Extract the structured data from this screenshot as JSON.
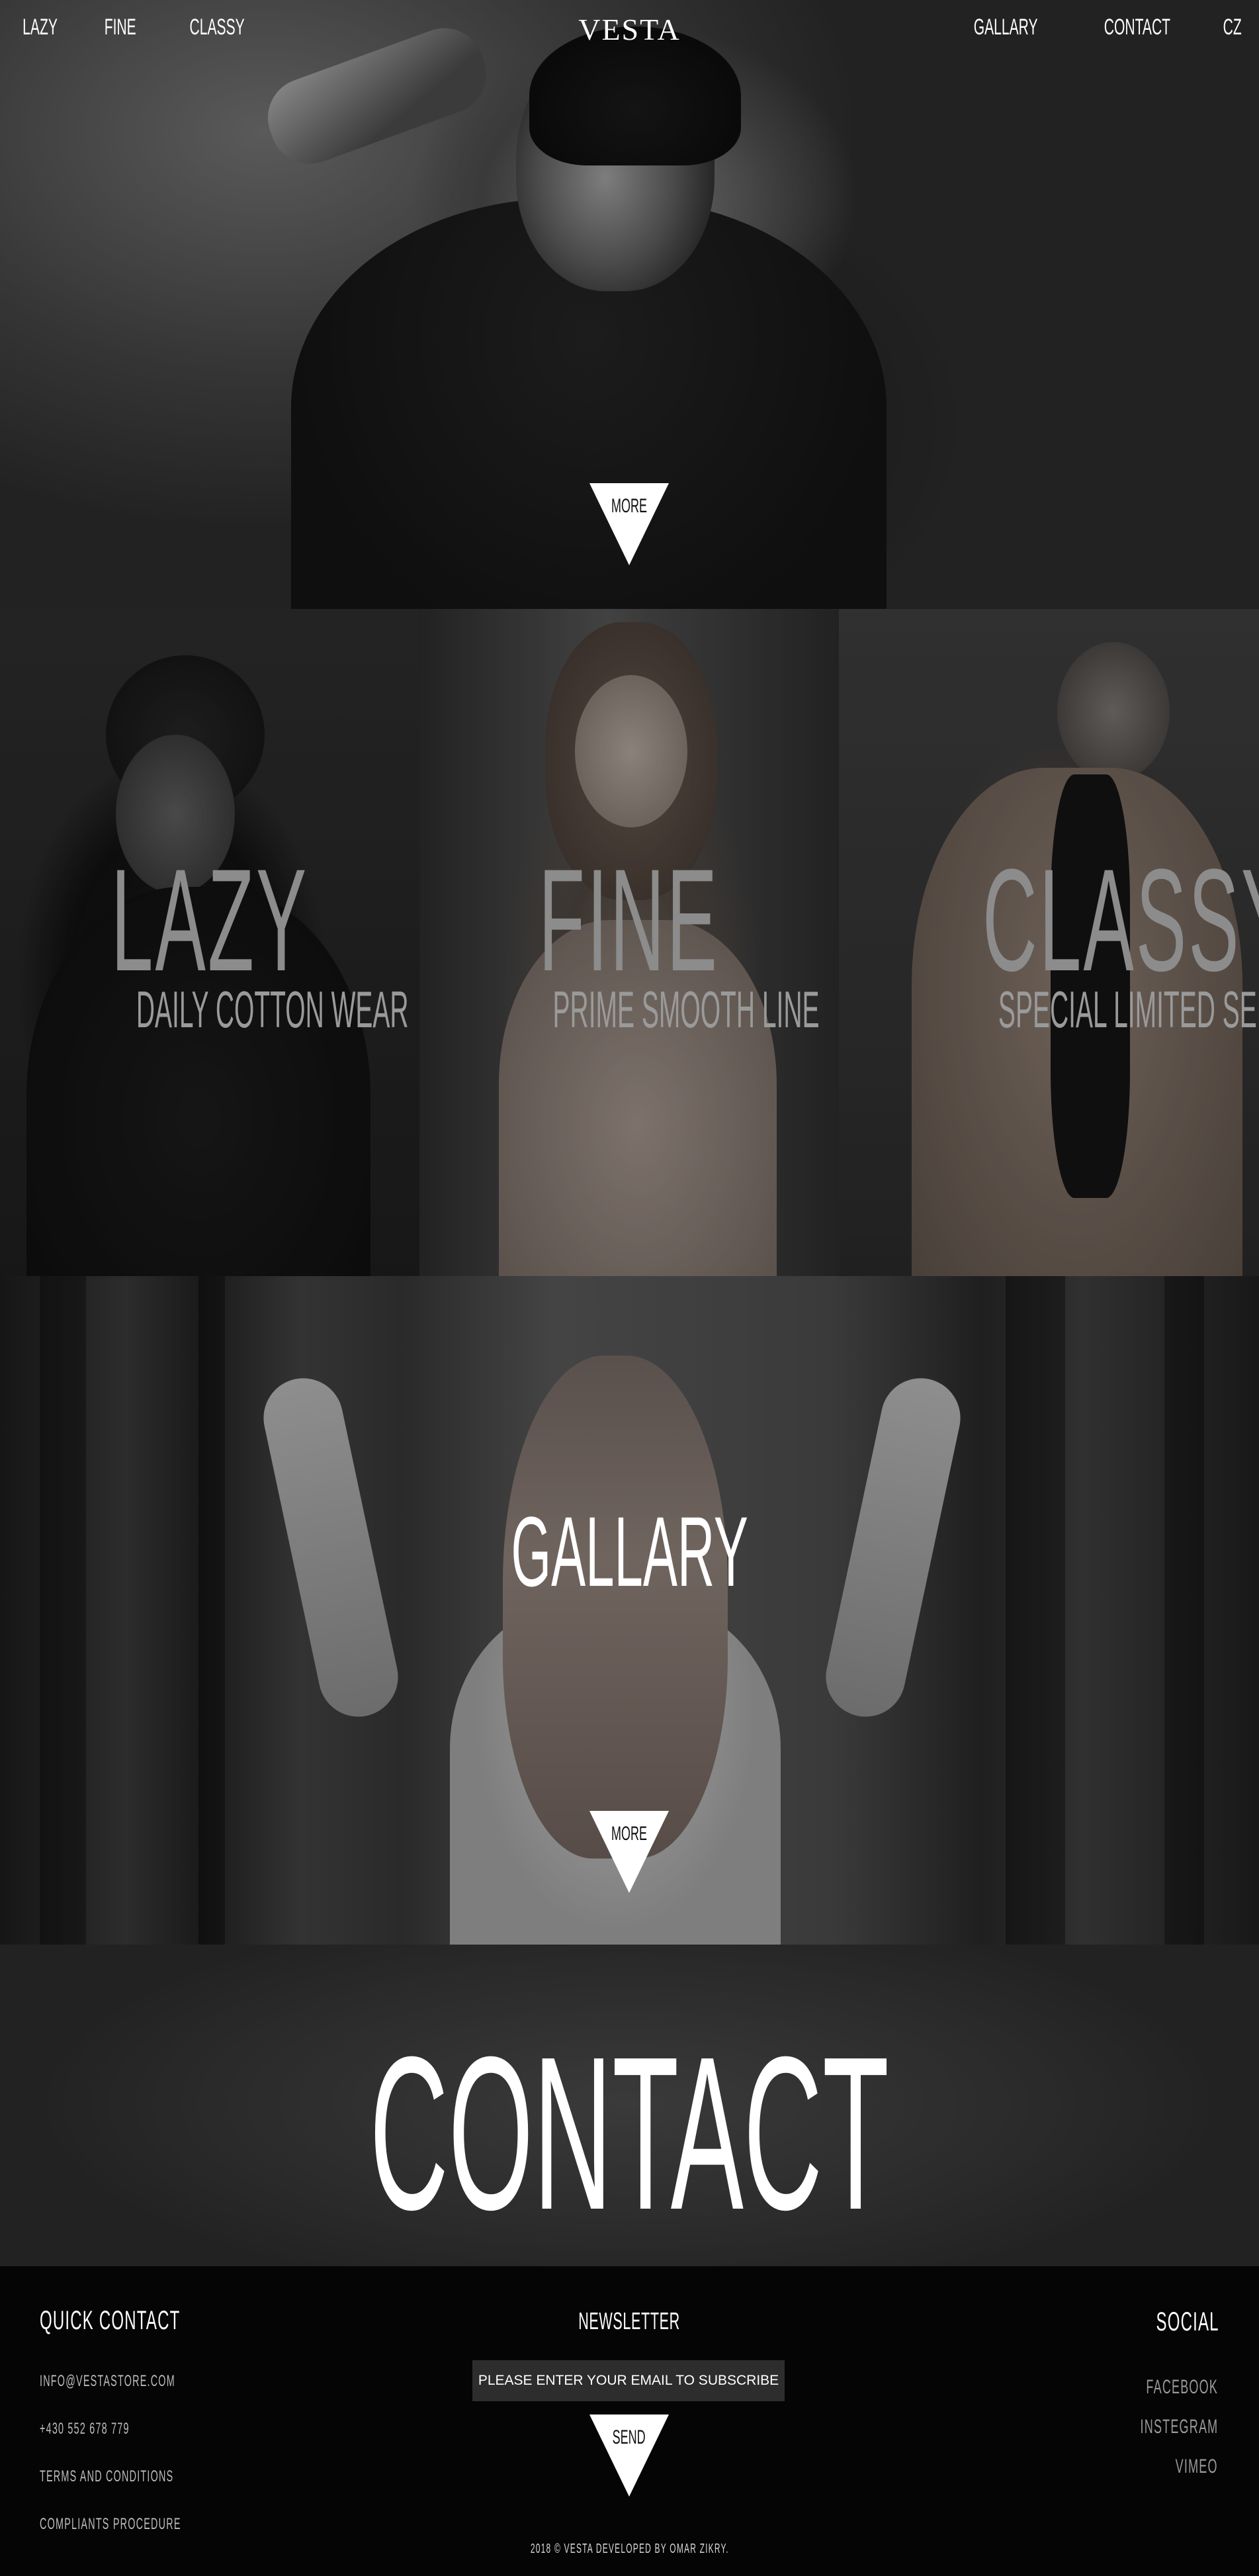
{
  "brand": "VESTA",
  "nav": {
    "left": [
      "LAZY",
      "FINE",
      "CLASSY"
    ],
    "right": [
      "GALLARY",
      "CONTACT",
      "CZ"
    ]
  },
  "hero": {
    "more_label": "MORE"
  },
  "categories": [
    {
      "title": "LAZY",
      "subtitle": "DAILY COTTON WEAR"
    },
    {
      "title": "FINE",
      "subtitle": "PRIME SMOOTH LINE"
    },
    {
      "title": "CLASSY",
      "subtitle": "SPECIAL LIMITED SERIES"
    }
  ],
  "gallary": {
    "title": "GALLARY",
    "more_label": "MORE"
  },
  "contact": {
    "title": "CONTACT"
  },
  "footer": {
    "quick_contact": {
      "heading": "QUICK CONTACT",
      "items": [
        "INFO@VESTASTORE.COM",
        "+430 552 678 779",
        "TERMS AND CONDITIONS",
        "COMPLIANTS PROCEDURE"
      ]
    },
    "newsletter": {
      "heading": "NEWSLETTER",
      "placeholder": "PLEASE ENTER YOUR EMAIL TO SUBSCRIBE",
      "send_label": "SEND"
    },
    "social": {
      "heading": "SOCIAL",
      "items": [
        "FACEBOOK",
        "INSTEGRAM",
        "VIMEO"
      ]
    },
    "copyright": "2018 © VESTA DEVELOPED BY OMAR ZIKRY."
  }
}
